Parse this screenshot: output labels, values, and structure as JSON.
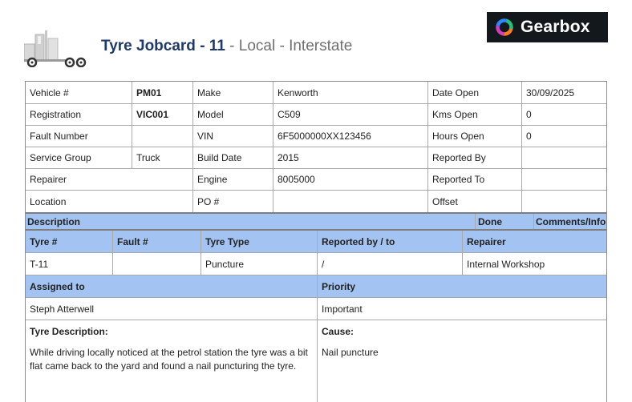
{
  "header": {
    "title": "Tyre Jobcard - 11",
    "subtitle": " - Local - Interstate",
    "logo_text": "Gearbox",
    "truck_icon": "truck-icon",
    "logo_icon": "gearbox-ring-icon"
  },
  "vehicle": {
    "vehicle_label": "Vehicle #",
    "vehicle_value": "PM01",
    "make_label": "Make",
    "make_value": "Kenworth",
    "date_open_label": "Date Open",
    "date_open_value": "30/09/2025",
    "registration_label": "Registration",
    "registration_value": "VIC001",
    "model_label": "Model",
    "model_value": "C509",
    "kms_open_label": "Kms Open",
    "kms_open_value": "0",
    "fault_number_label": "Fault Number",
    "fault_number_value": "",
    "vin_label": "VIN",
    "vin_value": "6F5000000XX123456",
    "hours_open_label": "Hours Open",
    "hours_open_value": "0",
    "service_group_label": "Service Group",
    "service_group_value": "Truck",
    "build_date_label": "Build Date",
    "build_date_value": "2015",
    "reported_by_label": "Reported By",
    "reported_by_value": "",
    "repairer_label": "Repairer",
    "repairer_value": "",
    "engine_label": "Engine",
    "engine_value": "8005000",
    "reported_to_label": "Reported To",
    "reported_to_value": "",
    "location_label": "Location",
    "location_value": "",
    "po_label": "PO #",
    "po_value": "",
    "offset_label": "Offset",
    "offset_value": ""
  },
  "description_header": {
    "description": "Description",
    "done": "Done",
    "comments": "Comments/Info"
  },
  "tyre_table": {
    "headers": [
      "Tyre #",
      "Fault #",
      "Tyre Type",
      "Reported by / to",
      "Repairer"
    ],
    "row": [
      "T-11",
      "",
      "Puncture",
      "/",
      "Internal Workshop"
    ]
  },
  "assignment": {
    "assigned_label": "Assigned to",
    "priority_label": "Priority",
    "assigned_value": "Steph Atterwell",
    "priority_value": "Important"
  },
  "details": {
    "tyre_description_label": "Tyre Description:",
    "tyre_description_text": "While driving locally noticed at the petrol station the tyre was a bit flat came back to the yard and found a nail puncturing the tyre.",
    "cause_label": "Cause:",
    "cause_text": "Nail puncture"
  },
  "colors": {
    "header_fill": "#a3c4f2",
    "title_color": "#1f3a68",
    "logo_background": "#13181d"
  }
}
